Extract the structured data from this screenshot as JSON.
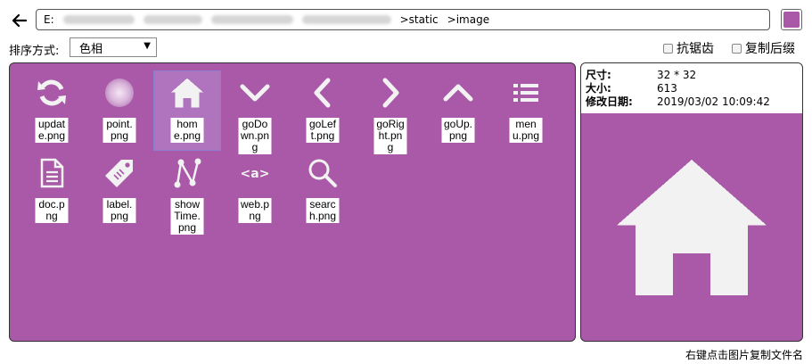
{
  "toolbar": {
    "path_prefix": "E:",
    "path_static": ">static",
    "path_image": ">image",
    "color_value": "#a959a7"
  },
  "sort": {
    "label": "排序方式:",
    "selected": "色相"
  },
  "options": {
    "antialias": "抗锯齿",
    "copy_ext": "复制后缀"
  },
  "files": [
    {
      "name": "update.png",
      "icon": "refresh-icon"
    },
    {
      "name": "point.png",
      "icon": "point-icon"
    },
    {
      "name": "home.png",
      "icon": "home-icon",
      "selected": true
    },
    {
      "name": "goDown.png",
      "icon": "chevron-down-icon"
    },
    {
      "name": "goLeft.png",
      "icon": "chevron-left-icon"
    },
    {
      "name": "goRight.png",
      "icon": "chevron-right-icon"
    },
    {
      "name": "goUp.png",
      "icon": "chevron-up-icon"
    },
    {
      "name": "menu.png",
      "icon": "menu-icon"
    },
    {
      "name": "doc.png",
      "icon": "document-icon"
    },
    {
      "name": "label.png",
      "icon": "tag-icon"
    },
    {
      "name": "showTime.png",
      "icon": "nodes-icon"
    },
    {
      "name": "web.png",
      "icon": "web-icon"
    },
    {
      "name": "search.png",
      "icon": "search-icon"
    }
  ],
  "info": {
    "size_label": "尺寸:",
    "size_value": "32 * 32",
    "bytes_label": "大小:",
    "bytes_value": "613",
    "date_label": "修改日期:",
    "date_value": "2019/03/02 10:09:42"
  },
  "hint": "右键点击图片复制文件名",
  "colors": {
    "panel_bg": "#a959a7",
    "icon_fg": "#f2f2f2"
  }
}
